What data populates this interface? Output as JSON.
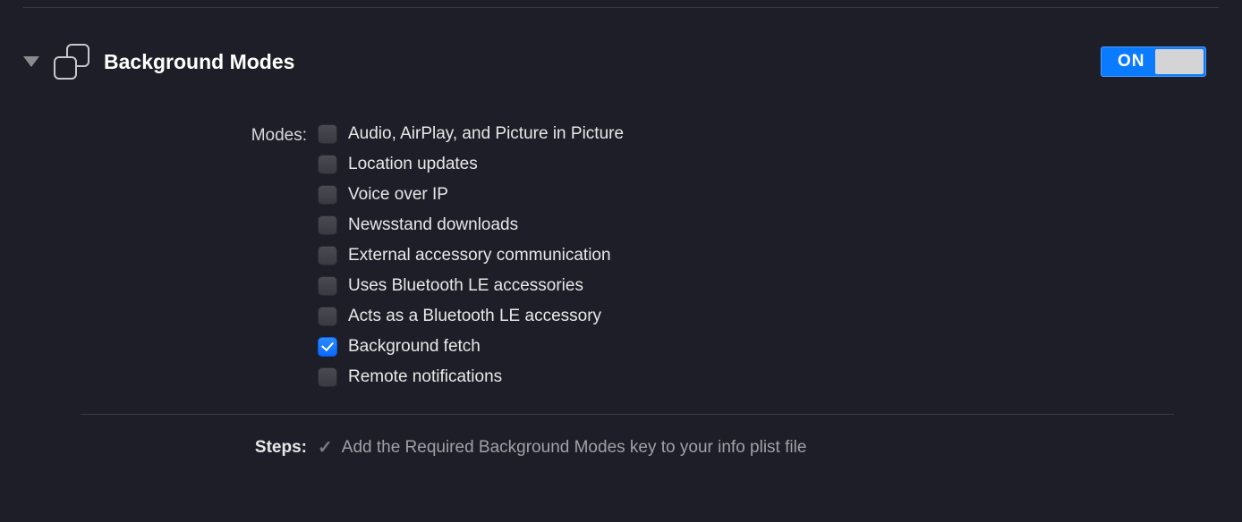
{
  "capability": {
    "title": "Background Modes",
    "toggle": {
      "on_label": "ON",
      "state": "on"
    }
  },
  "modes_section": {
    "label": "Modes:",
    "items": [
      {
        "label": "Audio, AirPlay, and Picture in Picture",
        "checked": false
      },
      {
        "label": "Location updates",
        "checked": false
      },
      {
        "label": "Voice over IP",
        "checked": false
      },
      {
        "label": "Newsstand downloads",
        "checked": false
      },
      {
        "label": "External accessory communication",
        "checked": false
      },
      {
        "label": "Uses Bluetooth LE accessories",
        "checked": false
      },
      {
        "label": "Acts as a Bluetooth LE accessory",
        "checked": false
      },
      {
        "label": "Background fetch",
        "checked": true
      },
      {
        "label": "Remote notifications",
        "checked": false
      }
    ]
  },
  "steps_section": {
    "label": "Steps:",
    "items": [
      {
        "text": "Add the Required Background Modes key to your info plist file",
        "done": true
      }
    ]
  }
}
